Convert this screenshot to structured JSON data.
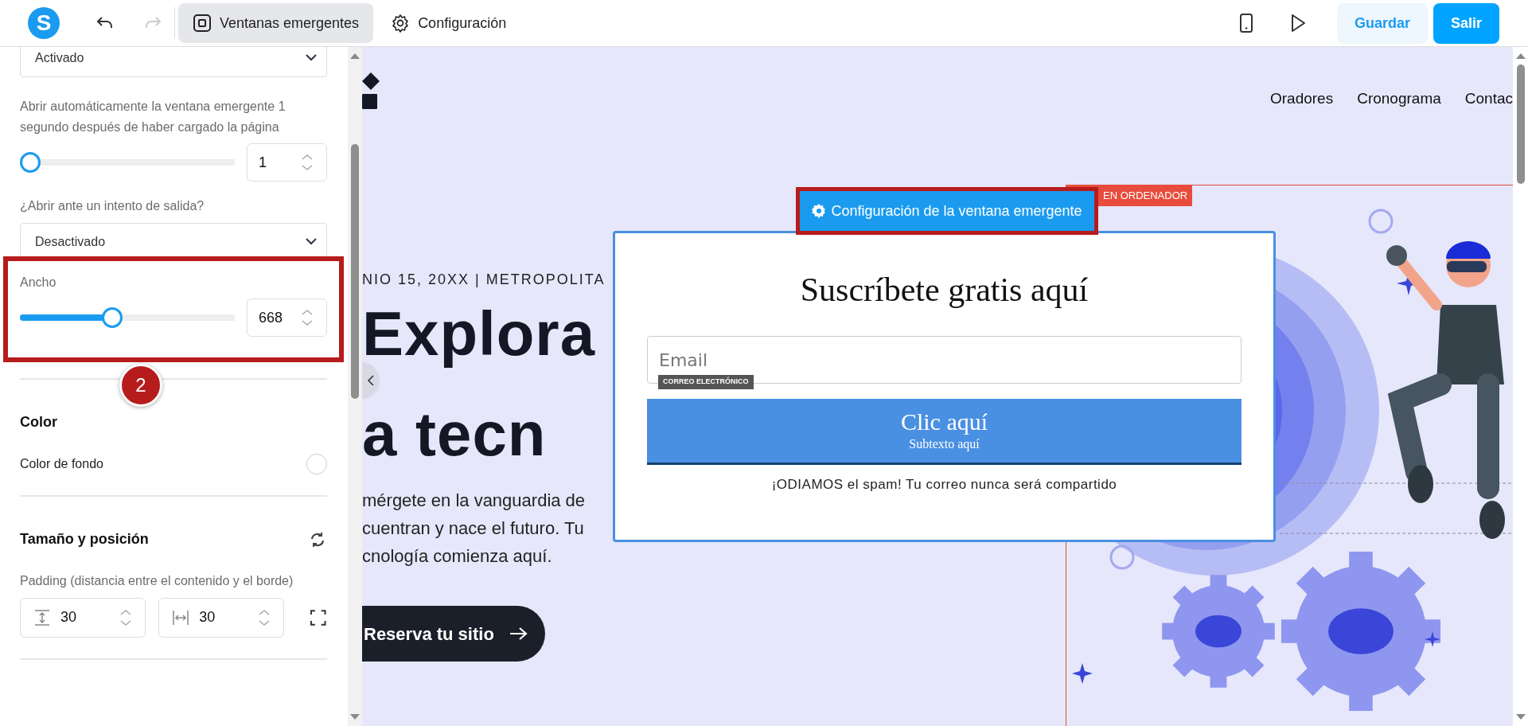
{
  "toolbar": {
    "app_logo": "S",
    "undo_disabled": false,
    "redo_disabled": true,
    "tabs": [
      {
        "label": "Ventanas emergentes",
        "selected": true
      },
      {
        "label": "Configuración",
        "selected": false
      }
    ],
    "buttons": [
      {
        "label": "Guardar",
        "kind": "secondary"
      },
      {
        "label": "Salir",
        "kind": "primary"
      }
    ]
  },
  "sidebar": {
    "items": [
      {
        "kind": "select",
        "value": "Activado"
      },
      {
        "kind": "slider",
        "label": "Abrir automáticamente la ventana emergente 1 segundo después de haber cargado la página",
        "level": 0.0,
        "value": "1"
      },
      {
        "kind": "select",
        "label": "¿Abrir ante un intento de salida?",
        "value": "Desactivado"
      },
      {
        "kind": "slider",
        "label": "Ancho",
        "level": 0.43,
        "value": "668",
        "highlighted": true,
        "annotation": "2"
      },
      {
        "kind": "divider"
      },
      {
        "kind": "heading",
        "label": "Color"
      },
      {
        "kind": "color",
        "label": "Color de fondo"
      },
      {
        "kind": "divider"
      },
      {
        "kind": "section",
        "label": "Tamaño y posición"
      },
      {
        "kind": "padding",
        "label": "Padding (distancia entre el contenido y el borde)",
        "values": [
          "30",
          "30"
        ]
      },
      {
        "kind": "divider"
      }
    ]
  },
  "site": {
    "nav": [
      "Oradores",
      "Cronograma",
      "Contac"
    ],
    "eyebrow": "NIO 15, 20XX | METROPOLITA",
    "headline": [
      "Explora",
      "a tecn"
    ],
    "intro": [
      "mérgete en la vanguardia de",
      "cuentran y nace el futuro. Tu",
      "cnología comienza aquí."
    ],
    "cta": "Reserva tu sitio",
    "section_tag": "EN ORDENADOR"
  },
  "popup": {
    "settings_tab": {
      "label": "Configuración de la ventana emergente",
      "highlighted": true
    },
    "title": "Suscríbete gratis aquí",
    "email": {
      "placeholder": "Email",
      "tag": "CORREO ELECTRÓNICO"
    },
    "button": {
      "label": "Clic aquí",
      "subtext": "Subtexto aquí"
    },
    "note": "¡ODIAMOS el spam! Tu correo nunca será compartido"
  }
}
